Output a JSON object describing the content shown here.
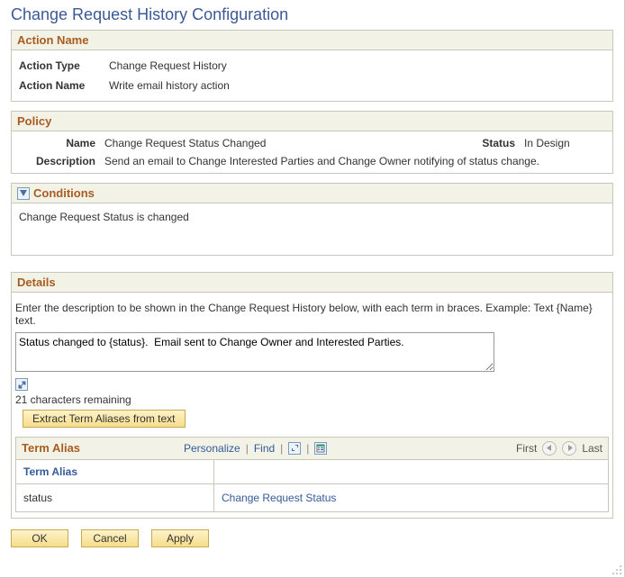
{
  "page": {
    "title": "Change Request History Configuration"
  },
  "actionName": {
    "header": "Action Name",
    "typeLabel": "Action Type",
    "typeValue": "Change Request History",
    "nameLabel": "Action Name",
    "nameValue": "Write email history action"
  },
  "policy": {
    "header": "Policy",
    "nameLabel": "Name",
    "nameValue": "Change Request Status Changed",
    "statusLabel": "Status",
    "statusValue": "In Design",
    "descLabel": "Description",
    "descValue": "Send an email to Change Interested Parties and Change Owner notifying of status change."
  },
  "conditions": {
    "header": "Conditions",
    "text": "Change Request Status is changed"
  },
  "details": {
    "header": "Details",
    "instruction": "Enter the description to be shown in the Change Request History below, with each term in braces. Example: Text {Name} text.",
    "textareaValue": "Status changed to {status}.  Email sent to Change Owner and Interested Parties.",
    "charsRemaining": "21 characters remaining",
    "extractButton": "Extract Term Aliases from text"
  },
  "termGrid": {
    "title": "Term Alias",
    "personalize": "Personalize",
    "find": "Find",
    "first": "First",
    "last": "Last",
    "colAlias": "Term Alias",
    "rows": [
      {
        "alias": "status",
        "term": "Change Request Status"
      }
    ]
  },
  "buttons": {
    "ok": "OK",
    "cancel": "Cancel",
    "apply": "Apply"
  }
}
